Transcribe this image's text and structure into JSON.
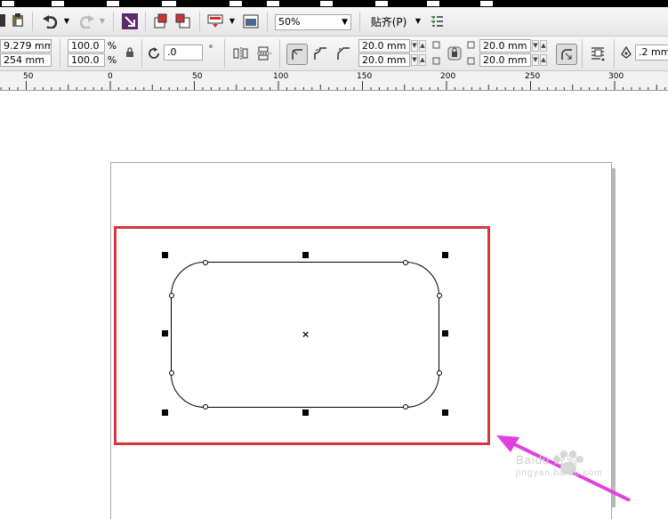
{
  "toolbar1": {
    "zoom_value": "50%",
    "snap_label": "贴齐(P)"
  },
  "toolbar2": {
    "width_value": "9.279 mm",
    "height_value": "254 mm",
    "scale_x": "100.0",
    "scale_y": "100.0",
    "percent_symbol": "%",
    "rotation_value": ".0",
    "degree_symbol": "°",
    "corner_tl": "20.0 mm",
    "corner_bl": "20.0 mm",
    "corner_tr": "20.0 mm",
    "corner_br": "20.0 mm",
    "outline_width": ".2 mm"
  },
  "ruler": {
    "labels": [
      "50",
      "0",
      "50",
      "100",
      "150",
      "200",
      "250",
      "300"
    ]
  },
  "watermark": {
    "text": "Baidu 经验",
    "subtext": "jingyan.baidu.com"
  },
  "colors": {
    "highlight_border": "#d9363e",
    "arrow": "#e040e0"
  }
}
